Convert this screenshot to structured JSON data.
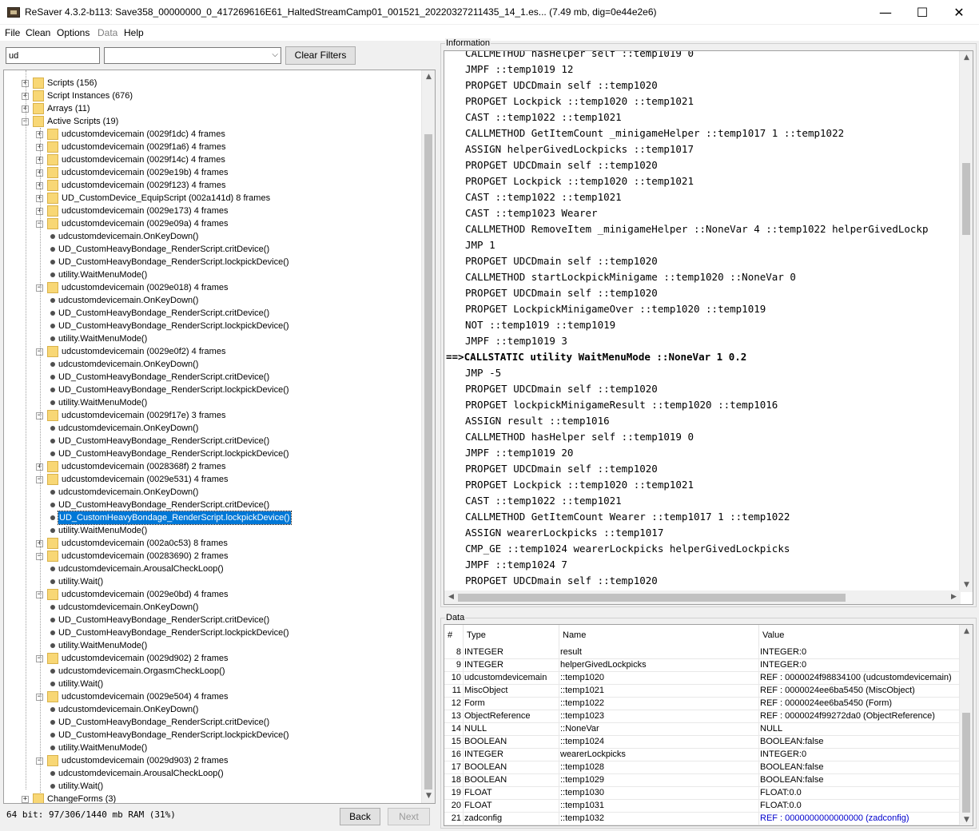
{
  "window": {
    "title": "ReSaver 4.3.2-b113: Save358_00000000_0_417269616E61_HaltedStreamCamp01_001521_20220327211435_14_1.es... (7.49 mb, dig=0e44e2e6)",
    "minimize": "—",
    "maximize": "☐",
    "close": "✕"
  },
  "menu": [
    "File",
    "Clean",
    "Options",
    "Data",
    "Help"
  ],
  "filter": {
    "search_value": "ud",
    "combo_value": "",
    "clear_label": "Clear Filters"
  },
  "tree": [
    {
      "level": 0,
      "label": "Scripts (156)",
      "icon": "folder",
      "exp": "+"
    },
    {
      "level": 0,
      "label": "Script Instances (676)",
      "icon": "folder",
      "exp": "+"
    },
    {
      "level": 0,
      "label": "Arrays (11)",
      "icon": "folder",
      "exp": "+"
    },
    {
      "level": 0,
      "label": "Active Scripts (19)",
      "icon": "folder",
      "exp": "-"
    },
    {
      "level": 1,
      "label": "udcustomdevicemain (0029f1dc) 4 frames",
      "icon": "folder",
      "exp": "+"
    },
    {
      "level": 1,
      "label": "udcustomdevicemain (0029f1a6) 4 frames",
      "icon": "folder",
      "exp": "+"
    },
    {
      "level": 1,
      "label": "udcustomdevicemain (0029f14c) 4 frames",
      "icon": "folder",
      "exp": "+"
    },
    {
      "level": 1,
      "label": "udcustomdevicemain (0029e19b) 4 frames",
      "icon": "folder",
      "exp": "+"
    },
    {
      "level": 1,
      "label": "udcustomdevicemain (0029f123) 4 frames",
      "icon": "folder",
      "exp": "+"
    },
    {
      "level": 1,
      "label": "UD_CustomDevice_EquipScript (002a141d) 8 frames",
      "icon": "folder",
      "exp": "+"
    },
    {
      "level": 1,
      "label": "udcustomdevicemain (0029e173) 4 frames",
      "icon": "folder",
      "exp": "+"
    },
    {
      "level": 1,
      "label": "udcustomdevicemain (0029e09a) 4 frames",
      "icon": "folder",
      "exp": "-"
    },
    {
      "level": 2,
      "label": "udcustomdevicemain.OnKeyDown()",
      "icon": "dot"
    },
    {
      "level": 2,
      "label": "UD_CustomHeavyBondage_RenderScript.critDevice()",
      "icon": "dot"
    },
    {
      "level": 2,
      "label": "UD_CustomHeavyBondage_RenderScript.lockpickDevice()",
      "icon": "dot"
    },
    {
      "level": 2,
      "label": "utility.WaitMenuMode()",
      "icon": "dot"
    },
    {
      "level": 1,
      "label": "udcustomdevicemain (0029e018) 4 frames",
      "icon": "folder",
      "exp": "-"
    },
    {
      "level": 2,
      "label": "udcustomdevicemain.OnKeyDown()",
      "icon": "dot"
    },
    {
      "level": 2,
      "label": "UD_CustomHeavyBondage_RenderScript.critDevice()",
      "icon": "dot"
    },
    {
      "level": 2,
      "label": "UD_CustomHeavyBondage_RenderScript.lockpickDevice()",
      "icon": "dot"
    },
    {
      "level": 2,
      "label": "utility.WaitMenuMode()",
      "icon": "dot"
    },
    {
      "level": 1,
      "label": "udcustomdevicemain (0029e0f2) 4 frames",
      "icon": "folder",
      "exp": "-"
    },
    {
      "level": 2,
      "label": "udcustomdevicemain.OnKeyDown()",
      "icon": "dot"
    },
    {
      "level": 2,
      "label": "UD_CustomHeavyBondage_RenderScript.critDevice()",
      "icon": "dot"
    },
    {
      "level": 2,
      "label": "UD_CustomHeavyBondage_RenderScript.lockpickDevice()",
      "icon": "dot"
    },
    {
      "level": 2,
      "label": "utility.WaitMenuMode()",
      "icon": "dot"
    },
    {
      "level": 1,
      "label": "udcustomdevicemain (0029f17e) 3 frames",
      "icon": "folder",
      "exp": "-"
    },
    {
      "level": 2,
      "label": "udcustomdevicemain.OnKeyDown()",
      "icon": "dot"
    },
    {
      "level": 2,
      "label": "UD_CustomHeavyBondage_RenderScript.critDevice()",
      "icon": "dot"
    },
    {
      "level": 2,
      "label": "UD_CustomHeavyBondage_RenderScript.lockpickDevice()",
      "icon": "dot"
    },
    {
      "level": 1,
      "label": "udcustomdevicemain (0028368f) 2 frames",
      "icon": "folder",
      "exp": "+"
    },
    {
      "level": 1,
      "label": "udcustomdevicemain (0029e531) 4 frames",
      "icon": "folder",
      "exp": "-"
    },
    {
      "level": 2,
      "label": "udcustomdevicemain.OnKeyDown()",
      "icon": "dot"
    },
    {
      "level": 2,
      "label": "UD_CustomHeavyBondage_RenderScript.critDevice()",
      "icon": "dot"
    },
    {
      "level": 2,
      "label": "UD_CustomHeavyBondage_RenderScript.lockpickDevice()",
      "icon": "dot",
      "selected": true
    },
    {
      "level": 2,
      "label": "utility.WaitMenuMode()",
      "icon": "dot"
    },
    {
      "level": 1,
      "label": "udcustomdevicemain (002a0c53) 8 frames",
      "icon": "folder",
      "exp": "+"
    },
    {
      "level": 1,
      "label": "udcustomdevicemain (00283690) 2 frames",
      "icon": "folder",
      "exp": "-"
    },
    {
      "level": 2,
      "label": "udcustomdevicemain.ArousalCheckLoop()",
      "icon": "dot"
    },
    {
      "level": 2,
      "label": "utility.Wait()",
      "icon": "dot"
    },
    {
      "level": 1,
      "label": "udcustomdevicemain (0029e0bd) 4 frames",
      "icon": "folder",
      "exp": "-"
    },
    {
      "level": 2,
      "label": "udcustomdevicemain.OnKeyDown()",
      "icon": "dot"
    },
    {
      "level": 2,
      "label": "UD_CustomHeavyBondage_RenderScript.critDevice()",
      "icon": "dot"
    },
    {
      "level": 2,
      "label": "UD_CustomHeavyBondage_RenderScript.lockpickDevice()",
      "icon": "dot"
    },
    {
      "level": 2,
      "label": "utility.WaitMenuMode()",
      "icon": "dot"
    },
    {
      "level": 1,
      "label": "udcustomdevicemain (0029d902) 2 frames",
      "icon": "folder",
      "exp": "-"
    },
    {
      "level": 2,
      "label": "udcustomdevicemain.OrgasmCheckLoop()",
      "icon": "dot"
    },
    {
      "level": 2,
      "label": "utility.Wait()",
      "icon": "dot"
    },
    {
      "level": 1,
      "label": "udcustomdevicemain (0029e504) 4 frames",
      "icon": "folder",
      "exp": "-"
    },
    {
      "level": 2,
      "label": "udcustomdevicemain.OnKeyDown()",
      "icon": "dot"
    },
    {
      "level": 2,
      "label": "UD_CustomHeavyBondage_RenderScript.critDevice()",
      "icon": "dot"
    },
    {
      "level": 2,
      "label": "UD_CustomHeavyBondage_RenderScript.lockpickDevice()",
      "icon": "dot"
    },
    {
      "level": 2,
      "label": "utility.WaitMenuMode()",
      "icon": "dot"
    },
    {
      "level": 1,
      "label": "udcustomdevicemain (0029d903) 2 frames",
      "icon": "folder",
      "exp": "-"
    },
    {
      "level": 2,
      "label": "udcustomdevicemain.ArousalCheckLoop()",
      "icon": "dot"
    },
    {
      "level": 2,
      "label": "utility.Wait()",
      "icon": "dot"
    },
    {
      "level": 0,
      "label": "ChangeForms (3)",
      "icon": "folder",
      "exp": "+"
    }
  ],
  "status_text": "64 bit: 97/306/1440 mb RAM (31%)",
  "nav": {
    "back": "Back",
    "next": "Next"
  },
  "information": {
    "title": "Information",
    "lines": [
      "CALLMETHOD hasHelper self ::temp1019 0",
      "JMPF ::temp1019 12",
      "PROPGET UDCDmain self ::temp1020",
      "PROPGET Lockpick ::temp1020 ::temp1021",
      "CAST ::temp1022 ::temp1021",
      "CALLMETHOD GetItemCount _minigameHelper ::temp1017 1 ::temp1022",
      "ASSIGN helperGivedLockpicks ::temp1017",
      "PROPGET UDCDmain self ::temp1020",
      "PROPGET Lockpick ::temp1020 ::temp1021",
      "CAST ::temp1022 ::temp1021",
      "CAST ::temp1023 Wearer",
      "CALLMETHOD RemoveItem _minigameHelper ::NoneVar 4 ::temp1022 helperGivedLockp",
      "JMP 1",
      "PROPGET UDCDmain self ::temp1020",
      "CALLMETHOD startLockpickMinigame ::temp1020 ::NoneVar 0",
      "PROPGET UDCDmain self ::temp1020",
      "PROPGET LockpickMinigameOver ::temp1020 ::temp1019",
      "NOT ::temp1019 ::temp1019",
      "JMPF ::temp1019 3",
      "==>CALLSTATIC utility WaitMenuMode ::NoneVar 1 0.2",
      "JMP -5",
      "PROPGET UDCDmain self ::temp1020",
      "PROPGET lockpickMinigameResult ::temp1020 ::temp1016",
      "ASSIGN result ::temp1016",
      "CALLMETHOD hasHelper self ::temp1019 0",
      "JMPF ::temp1019 20",
      "PROPGET UDCDmain self ::temp1020",
      "PROPGET Lockpick ::temp1020 ::temp1021",
      "CAST ::temp1022 ::temp1021",
      "CALLMETHOD GetItemCount Wearer ::temp1017 1 ::temp1022",
      "ASSIGN wearerLockpicks ::temp1017",
      "CMP_GE ::temp1024 wearerLockpicks helperGivedLockpicks",
      "JMPF ::temp1024 7",
      "PROPGET UDCDmain self ::temp1020"
    ],
    "current_index": 19
  },
  "data": {
    "title": "Data",
    "columns": [
      "#",
      "Type",
      "Name",
      "Value"
    ],
    "rows": [
      {
        "n": "8",
        "type": "INTEGER",
        "name": "result",
        "value": "INTEGER:0"
      },
      {
        "n": "9",
        "type": "INTEGER",
        "name": "helperGivedLockpicks",
        "value": "INTEGER:0"
      },
      {
        "n": "10",
        "type": "udcustomdevicemain",
        "name": "::temp1020",
        "value": "REF : 0000024f98834100 (udcustomdevicemain)"
      },
      {
        "n": "11",
        "type": "MiscObject",
        "name": "::temp1021",
        "value": "REF : 0000024ee6ba5450 (MiscObject)"
      },
      {
        "n": "12",
        "type": "Form",
        "name": "::temp1022",
        "value": "REF : 0000024ee6ba5450 (Form)"
      },
      {
        "n": "13",
        "type": "ObjectReference",
        "name": "::temp1023",
        "value": "REF : 0000024f99272da0 (ObjectReference)"
      },
      {
        "n": "14",
        "type": "NULL",
        "name": "::NoneVar",
        "value": "NULL"
      },
      {
        "n": "15",
        "type": "BOOLEAN",
        "name": "::temp1024",
        "value": "BOOLEAN:false"
      },
      {
        "n": "16",
        "type": "INTEGER",
        "name": "wearerLockpicks",
        "value": "INTEGER:0"
      },
      {
        "n": "17",
        "type": "BOOLEAN",
        "name": "::temp1028",
        "value": "BOOLEAN:false"
      },
      {
        "n": "18",
        "type": "BOOLEAN",
        "name": "::temp1029",
        "value": "BOOLEAN:false"
      },
      {
        "n": "19",
        "type": "FLOAT",
        "name": "::temp1030",
        "value": "FLOAT:0.0"
      },
      {
        "n": "20",
        "type": "FLOAT",
        "name": "::temp1031",
        "value": "FLOAT:0.0"
      },
      {
        "n": "21",
        "type": "zadconfig",
        "name": "::temp1032",
        "value": "REF : 0000000000000000 (zadconfig)",
        "link": true
      }
    ]
  }
}
